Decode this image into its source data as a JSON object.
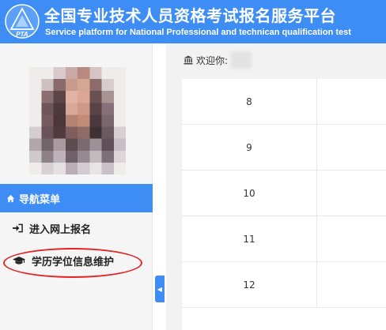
{
  "header": {
    "logo_text": "PTA",
    "title_cn": "全国专业技术人员资格考试报名服务平台",
    "title_en": "Service platform for National Professional and technican qualification test"
  },
  "sidebar": {
    "menu_header": "导航菜单",
    "items": [
      {
        "label": "进入网上报名",
        "icon": "sign-in-icon"
      },
      {
        "label": "学历学位信息维护",
        "icon": "graduation-cap-icon"
      }
    ]
  },
  "content": {
    "welcome_label": "欢迎你:",
    "rows": [
      {
        "no": "8"
      },
      {
        "no": "9"
      },
      {
        "no": "10"
      },
      {
        "no": "11"
      },
      {
        "no": "12"
      }
    ]
  },
  "colors": {
    "brand_blue": "#3d8df5",
    "highlight_red": "#e32222"
  }
}
